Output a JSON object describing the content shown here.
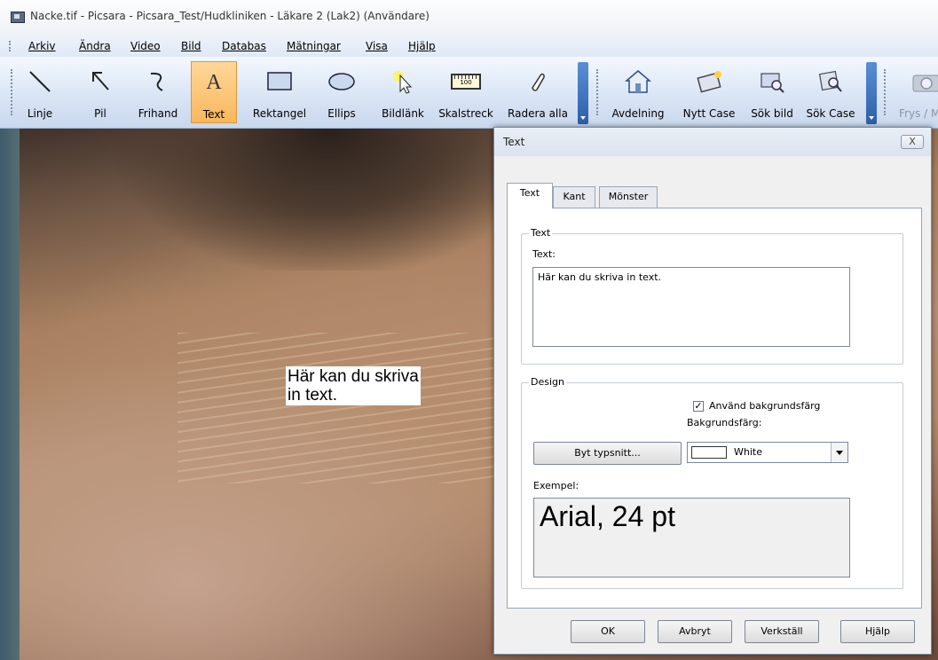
{
  "window": {
    "title": "Nacke.tif - Picsara - Picsara_Test/Hudkliniken - Läkare 2  (Lak2) (Användare)"
  },
  "menu": [
    "Arkiv",
    "Ändra",
    "Video",
    "Bild",
    "Databas",
    "Mätningar",
    "Visa",
    "Hjälp"
  ],
  "toolbar": {
    "tools": [
      {
        "label": "Linje",
        "icon": "line-icon"
      },
      {
        "label": "Pil",
        "icon": "arrow-icon"
      },
      {
        "label": "Frihand",
        "icon": "freehand-icon"
      },
      {
        "label": "Text",
        "icon": "text-icon",
        "active": true
      },
      {
        "label": "Rektangel",
        "icon": "rectangle-icon"
      },
      {
        "label": "Ellips",
        "icon": "ellipse-icon"
      },
      {
        "label": "Bildlänk",
        "icon": "image-link-icon"
      },
      {
        "label": "Skalstreck",
        "icon": "scale-bar-icon",
        "scale_text": "100"
      },
      {
        "label": "Radera alla",
        "icon": "eraser-icon"
      }
    ],
    "case_tools": [
      {
        "label": "Avdelning",
        "icon": "department-icon"
      },
      {
        "label": "Nytt Case",
        "icon": "new-case-icon"
      },
      {
        "label": "Sök bild",
        "icon": "search-image-icon"
      },
      {
        "label": "Sök Case",
        "icon": "search-case-icon"
      }
    ],
    "freeze_label": "Frys / M"
  },
  "annotation": {
    "text": "Här kan du skriva\nin text."
  },
  "dialog": {
    "title": "Text",
    "close_glyph": "X",
    "tabs": [
      "Text",
      "Kant",
      "Mönster"
    ],
    "text_group": {
      "legend": "Text",
      "label": "Text:",
      "value": "Här kan du skriva in text."
    },
    "design_group": {
      "legend": "Design",
      "use_bg_label": "Använd bakgrundsfärg",
      "use_bg_checked": true,
      "bg_label": "Bakgrundsfärg:",
      "bg_value": "White",
      "change_font_label": "Byt typsnitt...",
      "example_label": "Exempel:",
      "example_text": "Arial, 24 pt"
    },
    "buttons": {
      "ok": "OK",
      "cancel": "Avbryt",
      "apply": "Verkställ",
      "help": "Hjälp"
    }
  },
  "colors": {
    "toolbar_active": "#f8b75c",
    "toolbar_separator": "#2d5ea8",
    "dialog_bg": "#f0f0f0"
  }
}
